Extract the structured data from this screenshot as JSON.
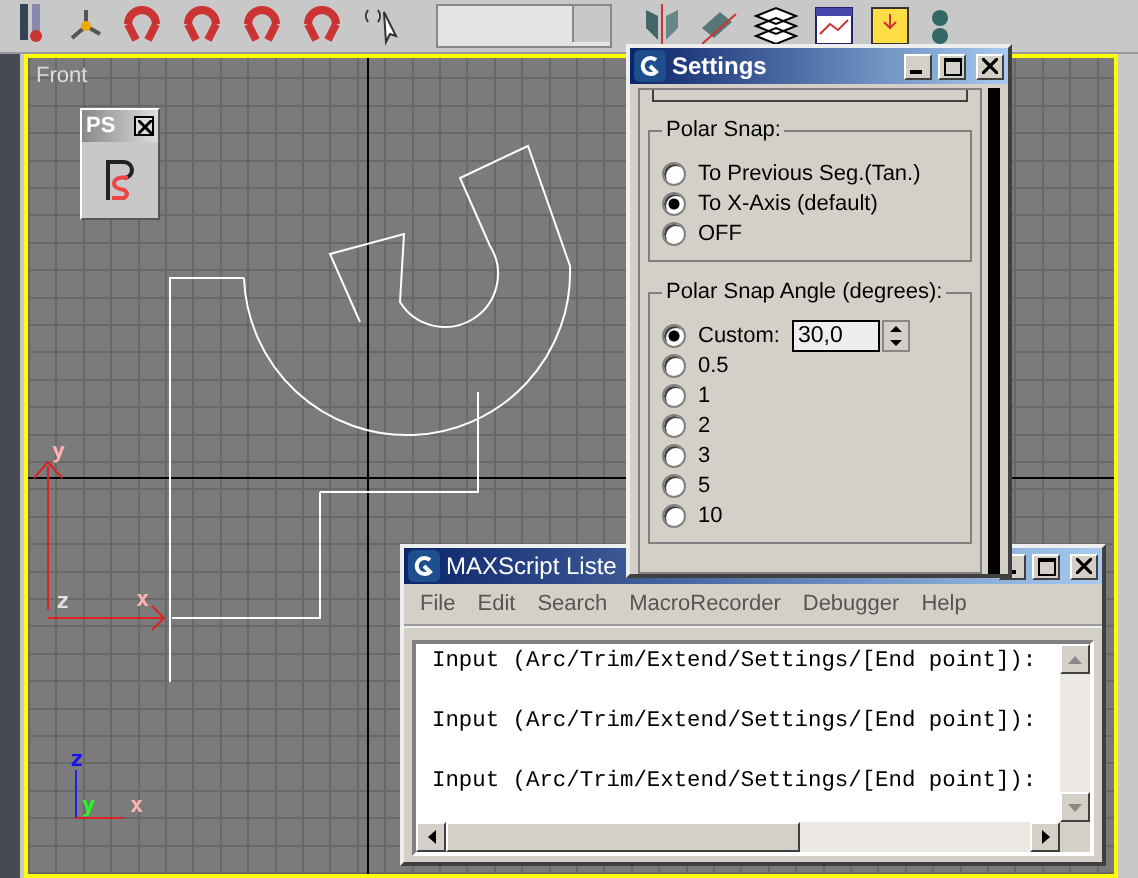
{
  "viewport": {
    "label": "Front",
    "gizmo_labels": [
      "y",
      "z",
      "x"
    ],
    "corner_axes": [
      "z",
      "y",
      "x"
    ]
  },
  "ps_window": {
    "title": "PS"
  },
  "settings": {
    "title": "Settings",
    "groups": [
      {
        "title": "Polar Snap:",
        "options": [
          {
            "label": "To Previous Seg.(Tan.)",
            "selected": false,
            "kind": "plain"
          },
          {
            "label": "To X-Axis (default)",
            "selected": true,
            "kind": "plain"
          },
          {
            "label": "OFF",
            "selected": false,
            "kind": "plain"
          }
        ]
      },
      {
        "title": "Polar Snap Angle (degrees):",
        "options": [
          {
            "label": "Custom:",
            "selected": true,
            "kind": "spinner",
            "value": "30,0"
          },
          {
            "label": "0.5",
            "selected": false,
            "kind": "plain"
          },
          {
            "label": "1",
            "selected": false,
            "kind": "plain"
          },
          {
            "label": "2",
            "selected": false,
            "kind": "plain"
          },
          {
            "label": "3",
            "selected": false,
            "kind": "plain"
          },
          {
            "label": "5",
            "selected": false,
            "kind": "plain"
          },
          {
            "label": "10",
            "selected": false,
            "kind": "plain"
          }
        ]
      }
    ]
  },
  "listener": {
    "title": "MAXScript Liste",
    "menu": [
      "File",
      "Edit",
      "Search",
      "MacroRecorder",
      "Debugger",
      "Help"
    ],
    "lines": [
      "Input (Arc/Trim/Extend/Settings/[End point]): ",
      "Input (Arc/Trim/Extend/Settings/[End point]): ",
      "Input (Arc/Trim/Extend/Settings/[End point]): "
    ]
  }
}
